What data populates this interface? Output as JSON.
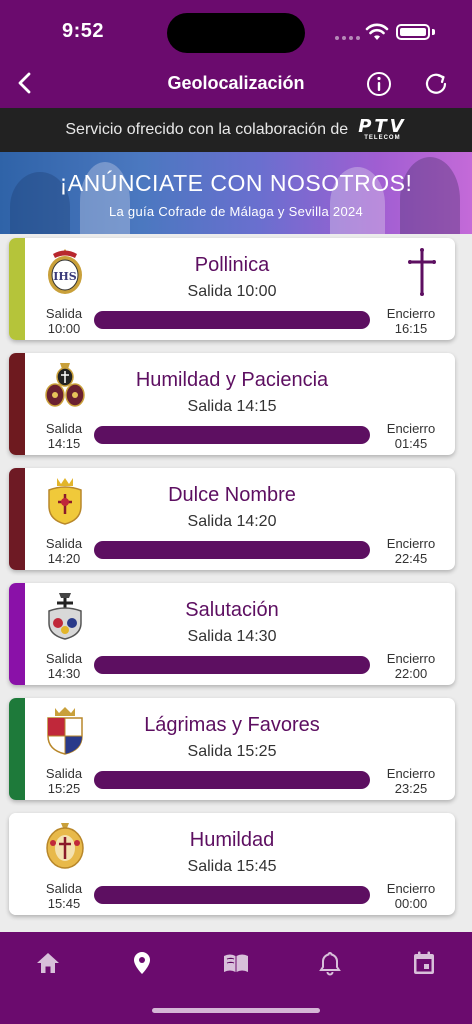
{
  "status": {
    "time": "9:52"
  },
  "nav": {
    "title": "Geolocalización"
  },
  "sponsor": {
    "text": "Servicio ofrecido con la colaboración de",
    "logo_main": "PTV",
    "logo_sub": "TELECOM"
  },
  "banner": {
    "title": "¡ANÚNCIATE CON NOSOTROS!",
    "subtitle": "La guía Cofrade de Málaga y Sevilla 2024"
  },
  "labels": {
    "salida": "Salida",
    "encierro": "Encierro"
  },
  "processions": [
    {
      "name": "Pollinica",
      "salida_text": "Salida 10:00",
      "salida": "10:00",
      "encierro": "16:15",
      "color": "#b5c43a",
      "shield": "shield-icon",
      "progress": 1.0
    },
    {
      "name": "Humildad y Paciencia",
      "salida_text": "Salida 14:15",
      "salida": "14:15",
      "encierro": "01:45",
      "color": "#6e1a1f",
      "shield": "shield-icon",
      "progress": 1.0
    },
    {
      "name": "Dulce Nombre",
      "salida_text": "Salida 14:20",
      "salida": "14:20",
      "encierro": "22:45",
      "color": "#6e1a24",
      "shield": "shield-icon",
      "progress": 1.0
    },
    {
      "name": "Salutación",
      "salida_text": "Salida 14:30",
      "salida": "14:30",
      "encierro": "22:00",
      "color": "#8a11a8",
      "shield": "shield-icon",
      "progress": 1.0
    },
    {
      "name": "Lágrimas y Favores",
      "salida_text": "Salida 15:25",
      "salida": "15:25",
      "encierro": "23:25",
      "color": "#1e7a3a",
      "shield": "shield-icon",
      "progress": 1.0
    },
    {
      "name": "Humildad",
      "salida_text": "Salida 15:45",
      "salida": "15:45",
      "encierro": "00:00",
      "color": "#ffffff",
      "shield": "shield-icon",
      "progress": 1.0
    }
  ],
  "tabs": [
    {
      "icon": "home-icon"
    },
    {
      "icon": "location-pin-icon"
    },
    {
      "icon": "book-icon"
    },
    {
      "icon": "bell-icon"
    },
    {
      "icon": "calendar-icon"
    }
  ]
}
